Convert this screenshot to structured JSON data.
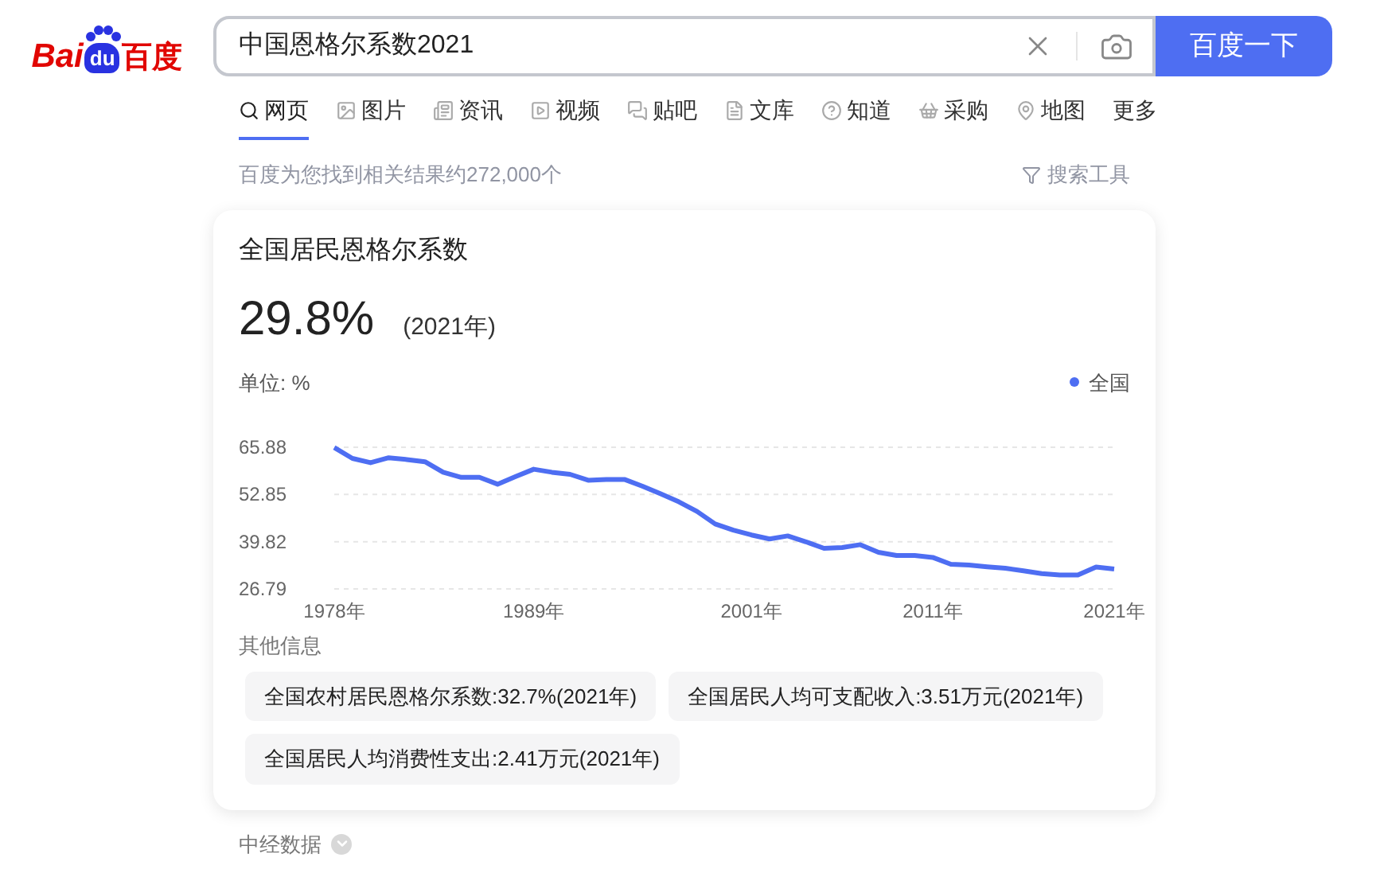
{
  "logo": {
    "left": "Bai",
    "mark": "du",
    "right": "百度"
  },
  "search": {
    "value": "中国恩格尔系数2021",
    "button": "百度一下"
  },
  "tabs": [
    {
      "kind": "web",
      "label": "网页",
      "selected": true
    },
    {
      "kind": "image",
      "label": "图片",
      "selected": false
    },
    {
      "kind": "news",
      "label": "资讯",
      "selected": false
    },
    {
      "kind": "video",
      "label": "视频",
      "selected": false
    },
    {
      "kind": "tieba",
      "label": "贴吧",
      "selected": false
    },
    {
      "kind": "doc",
      "label": "文库",
      "selected": false
    },
    {
      "kind": "zhidao",
      "label": "知道",
      "selected": false
    },
    {
      "kind": "shop",
      "label": "采购",
      "selected": false
    },
    {
      "kind": "map",
      "label": "地图",
      "selected": false
    },
    {
      "kind": "more",
      "label": "更多",
      "selected": false
    }
  ],
  "result_count": "百度为您找到相关结果约272,000个",
  "search_tools": "搜索工具",
  "card": {
    "title": "全国居民恩格尔系数",
    "value": "29.8%",
    "year": "(2021年)",
    "unit": "单位: %",
    "chart_data": {
      "type": "line",
      "x": [
        1978,
        1979,
        1980,
        1981,
        1982,
        1983,
        1984,
        1985,
        1986,
        1987,
        1988,
        1989,
        1990,
        1991,
        1992,
        1993,
        1994,
        1995,
        1996,
        1997,
        1998,
        1999,
        2000,
        2001,
        2002,
        2003,
        2004,
        2005,
        2006,
        2007,
        2008,
        2009,
        2010,
        2011,
        2012,
        2013,
        2014,
        2015,
        2016,
        2017,
        2018,
        2019,
        2020,
        2021
      ],
      "series": [
        {
          "name": "全国",
          "color": "#4e6ef2",
          "values": [
            65.8,
            62.8,
            61.6,
            63.0,
            62.5,
            61.9,
            59.0,
            57.6,
            57.6,
            55.7,
            57.8,
            59.8,
            59.0,
            58.4,
            56.8,
            57.0,
            57.0,
            55.1,
            53.0,
            50.8,
            48.2,
            44.7,
            43.0,
            41.7,
            40.6,
            41.4,
            39.8,
            38.0,
            38.2,
            39.0,
            36.9,
            36.0,
            36.0,
            35.5,
            33.6,
            33.4,
            32.9,
            32.5,
            31.8,
            31.0,
            30.6,
            30.6,
            32.8,
            32.3
          ]
        }
      ],
      "xlim": [
        1978,
        2021
      ],
      "ylim": [
        26.79,
        65.88
      ],
      "xticks": [
        {
          "value": 1978,
          "label": "1978年"
        },
        {
          "value": 1989,
          "label": "1989年"
        },
        {
          "value": 2001,
          "label": "2001年"
        },
        {
          "value": 2011,
          "label": "2011年"
        },
        {
          "value": 2021,
          "label": "2021年"
        }
      ],
      "yticks": [
        26.79,
        39.82,
        52.85,
        65.88
      ]
    },
    "other_title": "其他信息",
    "other_info": [
      "全国农村居民恩格尔系数:32.7%(2021年)",
      "全国居民人均可支配收入:3.51万元(2021年)",
      "全国居民人均消费性支出:2.41万元(2021年)"
    ]
  },
  "source": "中经数据"
}
